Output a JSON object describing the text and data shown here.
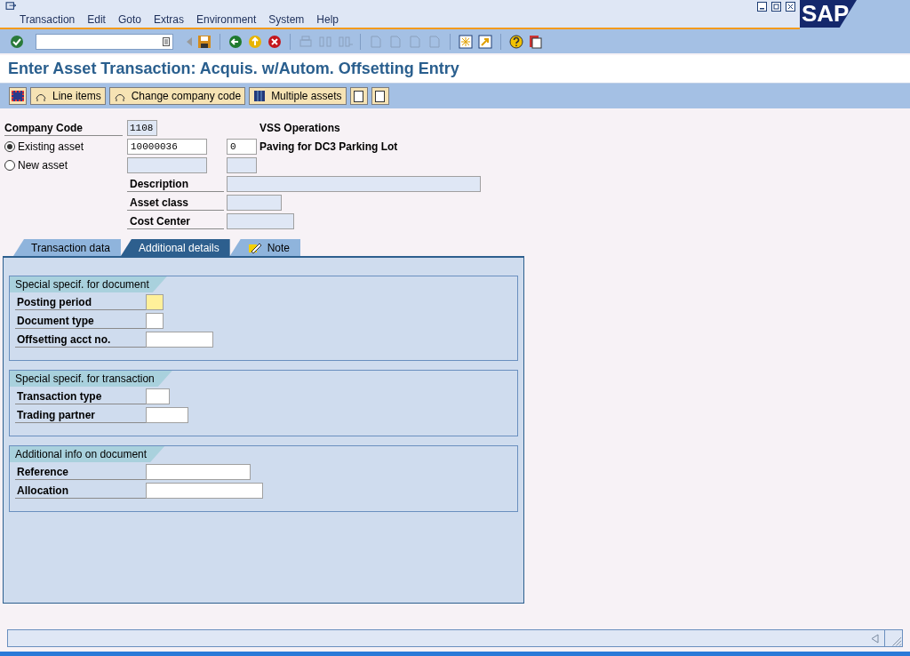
{
  "menu": [
    "Transaction",
    "Edit",
    "Goto",
    "Extras",
    "Environment",
    "System",
    "Help"
  ],
  "logo": "SAP",
  "title": "Enter Asset Transaction: Acquis. w/Autom. Offsetting Entry",
  "app_toolbar": [
    {
      "kind": "icon"
    },
    {
      "kind": "button",
      "label": "Line items"
    },
    {
      "kind": "button",
      "label": "Change company code"
    },
    {
      "kind": "button",
      "label": "Multiple assets"
    },
    {
      "kind": "icon"
    },
    {
      "kind": "icon"
    }
  ],
  "header": {
    "company_code": {
      "label": "Company Code",
      "value": "1108",
      "name": "VSS Operations"
    },
    "options": [
      {
        "label": "Existing asset",
        "selected": true,
        "asset": "10000036",
        "sub": "0",
        "text": "Paving for DC3 Parking Lot"
      },
      {
        "label": "New asset",
        "selected": false
      }
    ],
    "fields": [
      {
        "label": "Description"
      },
      {
        "label": "Asset class"
      },
      {
        "label": "Cost Center"
      }
    ]
  },
  "tabs": [
    {
      "label": "Transaction data",
      "selected": false
    },
    {
      "label": "Additional details",
      "selected": true
    },
    {
      "label": "Note",
      "selected": false,
      "icon": true
    }
  ],
  "groups": [
    {
      "title": "Special specif. for document",
      "fields": [
        {
          "label": "Posting period",
          "highlighted": true
        },
        {
          "label": "Document type",
          "highlighted": false
        },
        {
          "label": "Offsetting acct no.",
          "highlighted": false
        }
      ]
    },
    {
      "title": "Special specif. for transaction",
      "fields": [
        {
          "label": "Transaction type",
          "highlighted": false
        },
        {
          "label": "Trading partner",
          "highlighted": false
        }
      ]
    },
    {
      "title": "Additional info on document",
      "fields": [
        {
          "label": "Reference",
          "highlighted": false
        },
        {
          "label": "Allocation",
          "highlighted": false
        }
      ]
    }
  ]
}
